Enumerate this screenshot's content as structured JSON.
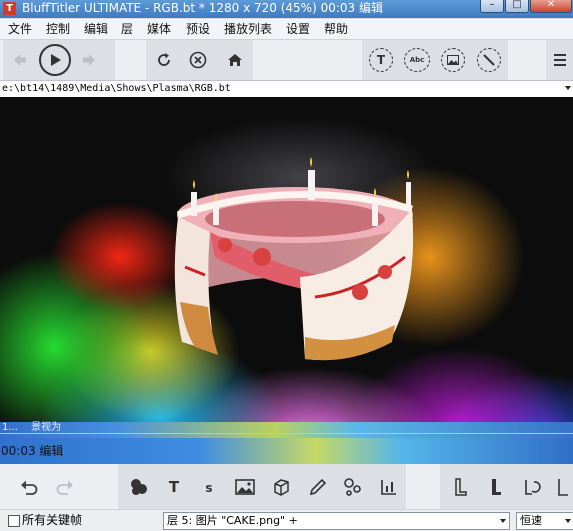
{
  "window": {
    "title": "BluffTitler ULTIMATE  - RGB.bt * 1280 x 720 (45%) 00:03 编辑",
    "app_icon": "T",
    "minimize": "–",
    "maximize": "□",
    "close": "✕"
  },
  "menu": [
    "文件",
    "控制",
    "编辑",
    "层",
    "媒体",
    "预设",
    "播放列表",
    "设置",
    "帮助"
  ],
  "toolbar": {
    "icons": [
      "back-arrow-icon",
      "play-icon",
      "forward-arrow-icon",
      "refresh-icon",
      "stop-icon",
      "home-icon",
      "text-layer-icon",
      "abc-text-icon",
      "picture-icon",
      "no-effect-icon",
      "menu-icon"
    ],
    "abc_label": "Abc",
    "t_label": "T"
  },
  "path": "e:\\bt14\\1489\\Media\\Shows\\Plasma\\RGB.bt",
  "timeline": {
    "label": "1... 　景视为"
  },
  "status": "00:03 编辑",
  "toolbar2": {
    "icons": [
      "undo-icon",
      "redo-icon",
      "layer-blob-icon",
      "text-icon",
      "small-text-icon",
      "picture-icon",
      "cube-icon",
      "pencil-icon",
      "particles-icon",
      "chart-icon",
      "column-l-icon",
      "column-l-icon",
      "rotate-icon",
      "audio-icon"
    ],
    "text_label": "T",
    "small_text_label": "s"
  },
  "bottom": {
    "all_keys_label": "所有关键帧",
    "all_keys_checked": false,
    "layer_select": "层 5: 图片 \"CAKE.png\" +",
    "speed_select": "恒速"
  },
  "colors": {
    "title_bar": "#3f7bbf",
    "toolbar_bg": "#eceef1",
    "viewport_bg": "#0c0c0c"
  }
}
